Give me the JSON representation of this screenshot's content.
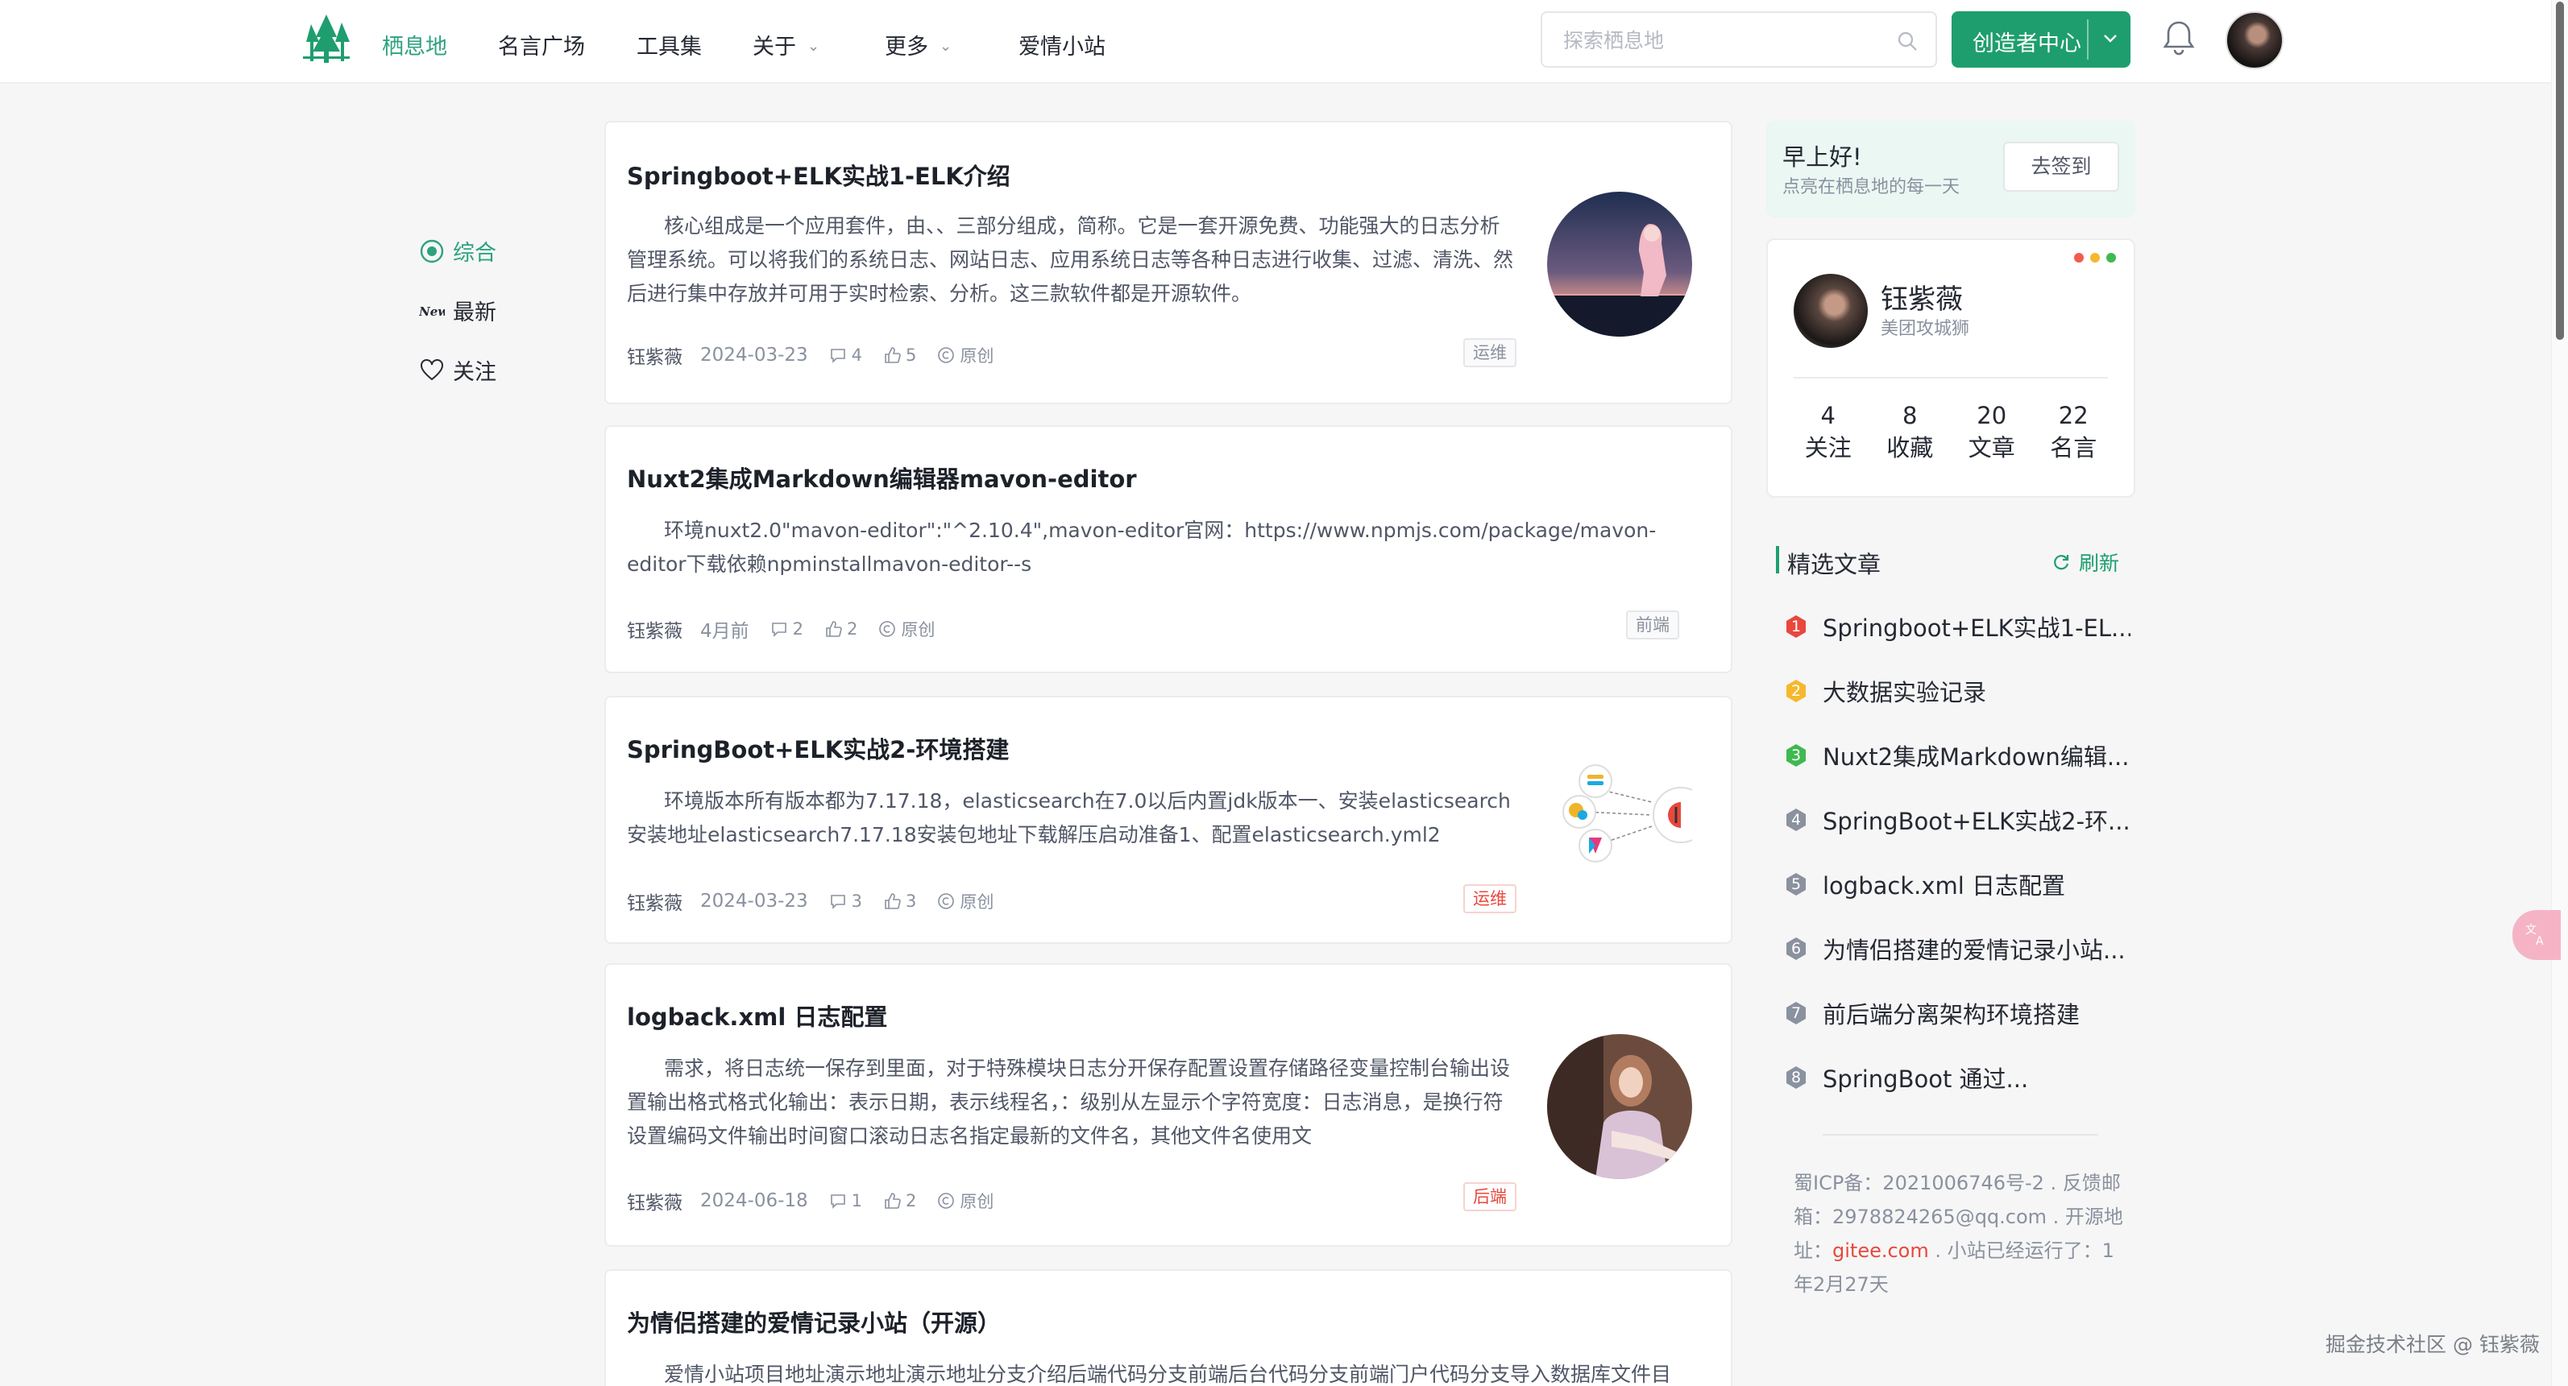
{
  "header": {
    "nav": [
      {
        "label": "栖息地",
        "active": true,
        "has_dropdown": false
      },
      {
        "label": "名言广场",
        "active": false,
        "has_dropdown": false
      },
      {
        "label": "工具集",
        "active": false,
        "has_dropdown": false
      },
      {
        "label": "关于",
        "active": false,
        "has_dropdown": true
      },
      {
        "label": "更多",
        "active": false,
        "has_dropdown": true
      },
      {
        "label": "爱情小站",
        "active": false,
        "has_dropdown": false
      }
    ],
    "search_placeholder": "探索栖息地",
    "creator_button": "创造者中心",
    "accent_color": "#1e9e6e"
  },
  "categories": [
    {
      "label": "综合",
      "icon": "radio-dot-icon",
      "active": true
    },
    {
      "label": "最新",
      "icon": "new-badge-icon",
      "active": false
    },
    {
      "label": "关注",
      "icon": "heart-icon",
      "active": false
    }
  ],
  "articles": [
    {
      "title": "Springboot+ELK实战1-ELK介绍",
      "summary": "核心组成是一个应用套件，由、、三部分组成，简称。它是一套开源免费、功能强大的日志分析管理系统。可以将我们的系统日志、网站日志、应用系统日志等各种日志进行收集、过滤、清洗、然后进行集中存放并可用于实时检索、分析。这三款软件都是开源软件。",
      "author": "钰紫薇",
      "date": "2024-03-23",
      "comments": "4",
      "likes": "5",
      "original": "原创",
      "tag": "运维",
      "tag_style": "gray",
      "thumbnail": "night-sky-girl-image"
    },
    {
      "title": "Nuxt2集成Markdown编辑器mavon-editor",
      "summary": "环境nuxt2.0\"mavon-editor\":\"^2.10.4\",mavon-editor官网：https://www.npmjs.com/package/mavon-editor下载依赖npminstallmavon-editor--s",
      "author": "钰紫薇",
      "date": "4月前",
      "comments": "2",
      "likes": "2",
      "original": "原创",
      "tag": "前端",
      "tag_style": "gray",
      "thumbnail": null
    },
    {
      "title": "SpringBoot+ELK实战2-环境搭建",
      "summary": "环境版本所有版本都为7.17.18，elasticsearch在7.0以后内置jdk版本一、安装elasticsearch安装地址elasticsearch7.17.18安装包地址下载解压启动准备1、配置elasticsearch.yml2",
      "author": "钰紫薇",
      "date": "2024-03-23",
      "comments": "3",
      "likes": "3",
      "original": "原创",
      "tag": "运维",
      "tag_style": "red",
      "thumbnail": "elk-diagram-image"
    },
    {
      "title": "logback.xml 日志配置",
      "summary": "需求，将日志统一保存到里面，对于特殊模块日志分开保存配置设置存储路径变量控制台输出设置输出格式格式化输出：表示日期，表示线程名，：级别从左显示个字符宽度：日志消息，是换行符设置编码文件输出时间窗口滚动日志名指定最新的文件名，其他文件名使用文",
      "author": "钰紫薇",
      "date": "2024-06-18",
      "comments": "1",
      "likes": "2",
      "original": "原创",
      "tag": "后端",
      "tag_style": "red",
      "thumbnail": "girl-portrait-image"
    },
    {
      "title": "为情侣搭建的爱情记录小站（开源）",
      "summary": "爱情小站项目地址演示地址演示地址分支介绍后端代码分支前端后台代码分支前端门户代码分支导入数据库文件目"
    }
  ],
  "greeting": {
    "title": "早上好!",
    "subtitle": "点亮在栖息地的每一天",
    "checkin": "去签到"
  },
  "profile": {
    "name": "钰紫薇",
    "role": "美团攻城狮",
    "stats": [
      {
        "value": "4",
        "label": "关注"
      },
      {
        "value": "8",
        "label": "收藏"
      },
      {
        "value": "20",
        "label": "文章"
      },
      {
        "value": "22",
        "label": "名言"
      }
    ]
  },
  "picks": {
    "title": "精选文章",
    "refresh": "刷新",
    "items": [
      {
        "rank": "1",
        "title": "Springboot+ELK实战1-EL...",
        "color": "#e8483d"
      },
      {
        "rank": "2",
        "title": "大数据实验记录",
        "color": "#f5b82e"
      },
      {
        "rank": "3",
        "title": "Nuxt2集成Markdown编辑...",
        "color": "#3fb950"
      },
      {
        "rank": "4",
        "title": "SpringBoot+ELK实战2-环...",
        "color": "#8a919f"
      },
      {
        "rank": "5",
        "title": "logback.xml 日志配置",
        "color": "#8a919f"
      },
      {
        "rank": "6",
        "title": "为情侣搭建的爱情记录小站...",
        "color": "#8a919f"
      },
      {
        "rank": "7",
        "title": "前后端分离架构环境搭建",
        "color": "#8a919f"
      },
      {
        "rank": "8",
        "title": "SpringBoot 通过...",
        "color": "#8a919f"
      }
    ]
  },
  "footer": {
    "icp": "蜀ICP备：2021006746号-2 . 反馈邮箱：2978824265@qq.com . 开源地址：",
    "link": "gitee.com",
    "uptime": " . 小站已经运行了：1年2月27天"
  },
  "watermark": "掘金技术社区 @ 钰紫薇"
}
